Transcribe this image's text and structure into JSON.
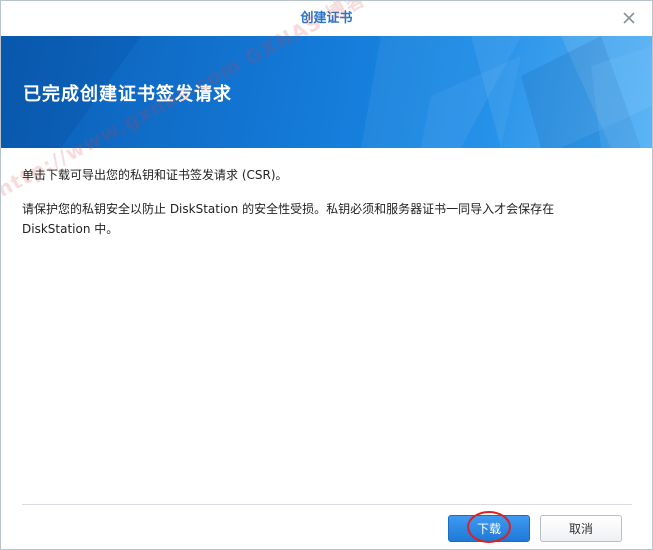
{
  "dialog": {
    "title": "创建证书",
    "banner_title": "已完成创建证书签发请求"
  },
  "content": {
    "paragraph1": "单击下载可导出您的私钥和证书签发请求 (CSR)。",
    "paragraph2_line1": "请保护您的私钥安全以防止 DiskStation 的安全性受损。私钥必须和服务器证书一同导入才会保存在",
    "paragraph2_line2": "DiskStation 中。"
  },
  "watermark": "http://www.gxnas.com GXNAS 博客",
  "footer": {
    "download_label": "下载",
    "cancel_label": "取消"
  },
  "icons": {
    "close": "close-icon"
  },
  "colors": {
    "accent": "#2b75c9",
    "banner": "#1478d6",
    "primary_button": "#2a86e2",
    "highlight": "#e02020"
  }
}
